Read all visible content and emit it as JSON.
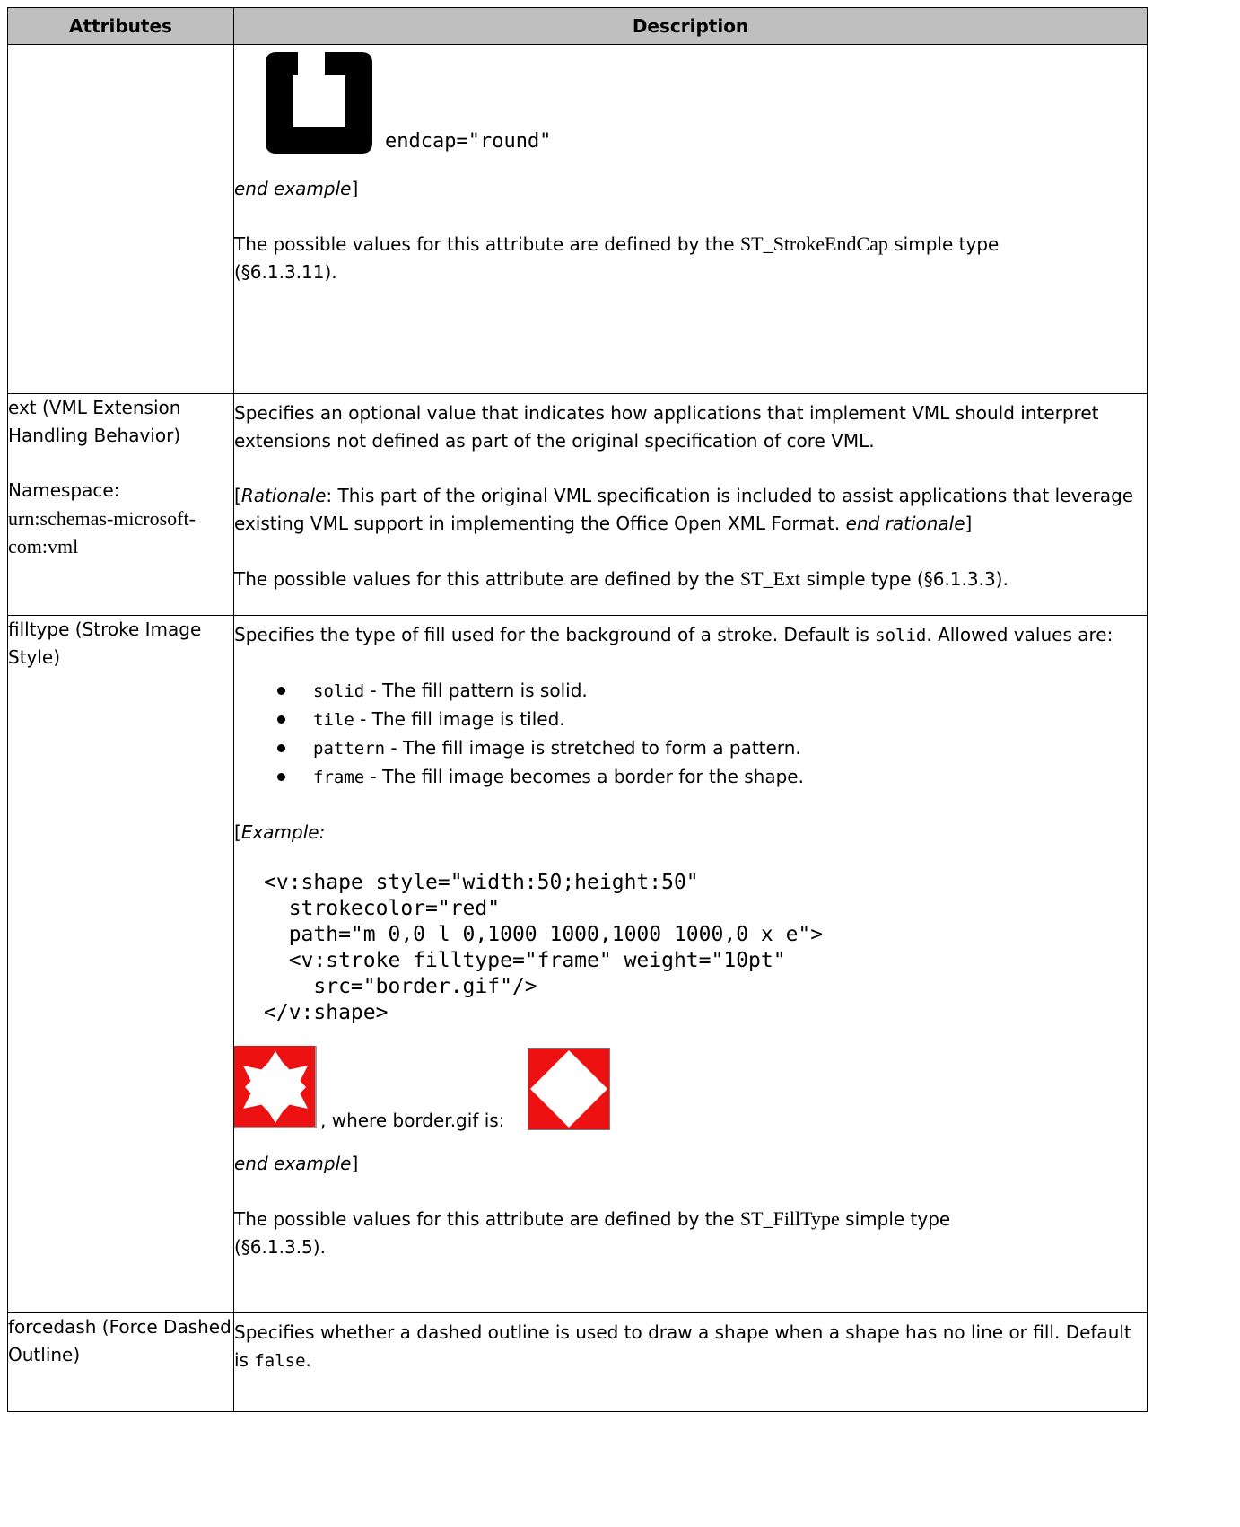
{
  "table": {
    "headers": {
      "attributes": "Attributes",
      "description": "Description"
    }
  },
  "row1": {
    "cap_label": "endcap=\"round\"",
    "end_example_italic": "end example",
    "end_example_bracket": "]",
    "values_pre": "The possible values for this attribute are defined by the ",
    "values_type": "ST_StrokeEndCap",
    "values_post": " simple type",
    "values_ref": "(§6.1.3.11)."
  },
  "row2": {
    "attr_name": "ext (VML Extension Handling Behavior)",
    "namespace_label": "Namespace:",
    "namespace_value": "urn:schemas-microsoft-com:vml",
    "desc": "Specifies an optional value that indicates how applications that implement VML should interpret extensions not defined as part of the original specification of core VML.",
    "rationale_open": "[",
    "rationale_label": "Rationale",
    "rationale_text": ": This part of the original VML specification is included to assist applications that leverage existing VML support in implementing the Office Open XML Format. ",
    "rationale_end": "end rationale",
    "rationale_close": "]",
    "values_pre": "The possible values for this attribute are defined by the ",
    "values_type": "ST_Ext",
    "values_post": " simple type (§6.1.3.3)."
  },
  "row3": {
    "attr_name": "filltype (Stroke Image Style)",
    "desc_pre": "Specifies the type of fill used for the background of a stroke.  Default is ",
    "desc_default": "solid",
    "desc_post": ".  Allowed values are:",
    "items": [
      {
        "code": "solid",
        "text": " - The fill pattern is solid."
      },
      {
        "code": "tile",
        "text": " - The fill image is tiled."
      },
      {
        "code": "pattern",
        "text": " - The fill image is stretched to form a pattern."
      },
      {
        "code": "frame",
        "text": " - The fill image becomes a border for the shape."
      }
    ],
    "example_open": "[",
    "example_label": "Example:",
    "code": "<v:shape style=\"width:50;height:50\"\n  strokecolor=\"red\"\n  path=\"m 0,0 l 0,1000 1000,1000 1000,0 x e\">\n  <v:stroke filltype=\"frame\" weight=\"10pt\"\n    src=\"border.gif\"/>\n</v:shape>",
    "where_text": ", where border.gif is:",
    "end_example_italic": "end example",
    "end_example_bracket": "]",
    "values_pre": "The possible values for this attribute are defined by the ",
    "values_type": "ST_FillType",
    "values_post": " simple type",
    "values_ref": "(§6.1.3.5)."
  },
  "row4": {
    "attr_name": "forcedash (Force Dashed Outline)",
    "desc_pre": "Specifies whether a dashed outline is used to draw a shape when a shape has no line or fill.  Default is ",
    "desc_default": "false",
    "desc_post": "."
  },
  "colors": {
    "header_bg": "#bfbfbf",
    "red": "#ee1111",
    "border": "#000000"
  }
}
